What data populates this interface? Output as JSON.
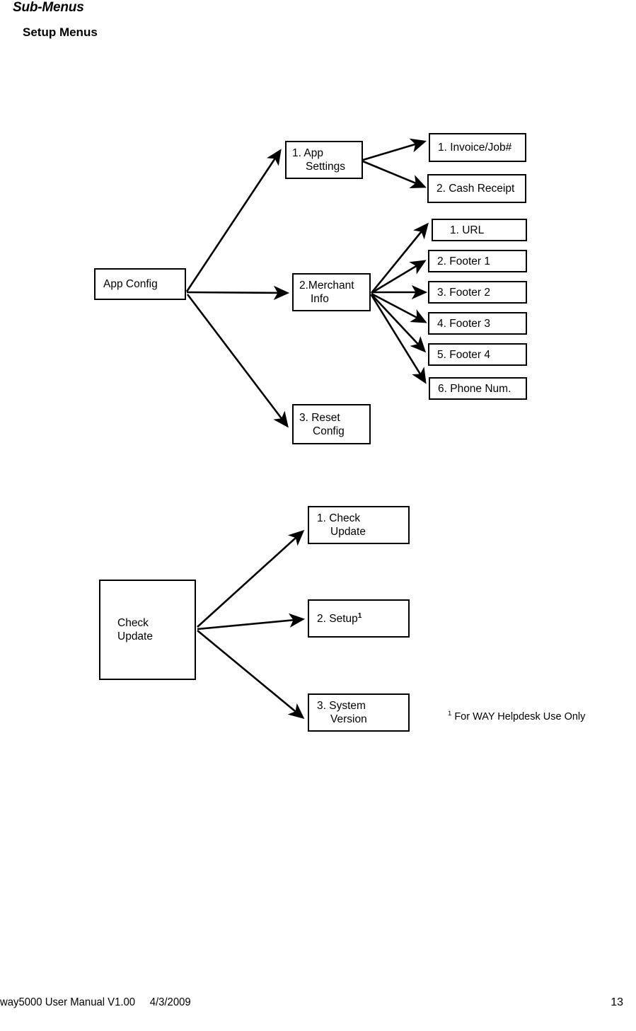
{
  "headings": {
    "section": "Sub-Menus",
    "subsection": "Setup Menus"
  },
  "diagrams": [
    {
      "id": "app-config",
      "root": {
        "label": "App Config"
      },
      "branches": [
        {
          "id": "app-settings",
          "line1": "1. App",
          "line2": "Settings",
          "children": [
            {
              "id": "invoice-job",
              "label": "1. Invoice/Job#"
            },
            {
              "id": "cash-receipt",
              "label": "2. Cash Receipt"
            }
          ]
        },
        {
          "id": "merchant-info",
          "line1": "2.Merchant",
          "line2": "Info",
          "children": [
            {
              "id": "url",
              "label": "1. URL"
            },
            {
              "id": "footer-1",
              "label": "2. Footer 1"
            },
            {
              "id": "footer-2",
              "label": "3. Footer 2"
            },
            {
              "id": "footer-3",
              "label": "4. Footer 3"
            },
            {
              "id": "footer-4",
              "label": "5. Footer 4"
            },
            {
              "id": "phone-num",
              "label": "6. Phone Num."
            }
          ]
        },
        {
          "id": "reset-config",
          "line1": "3. Reset",
          "line2": "Config",
          "children": []
        }
      ]
    },
    {
      "id": "check-update",
      "root": {
        "line1": "Check",
        "line2": "Update"
      },
      "branches": [
        {
          "id": "check-update-child",
          "line1": "1. Check",
          "line2": "Update"
        },
        {
          "id": "setup",
          "line1": "2. Setup",
          "footnote_marker": "1",
          "line2": ""
        },
        {
          "id": "system-version",
          "line1": "3. System",
          "line2": "Version"
        }
      ]
    }
  ],
  "footnote": {
    "marker": "1",
    "text": " For WAY Helpdesk Use Only"
  },
  "page_footer": {
    "left": "way5000 User Manual V1.00     4/3/2009",
    "page_number": "13"
  },
  "colors": {
    "ink": "#000000",
    "paper": "#ffffff"
  }
}
